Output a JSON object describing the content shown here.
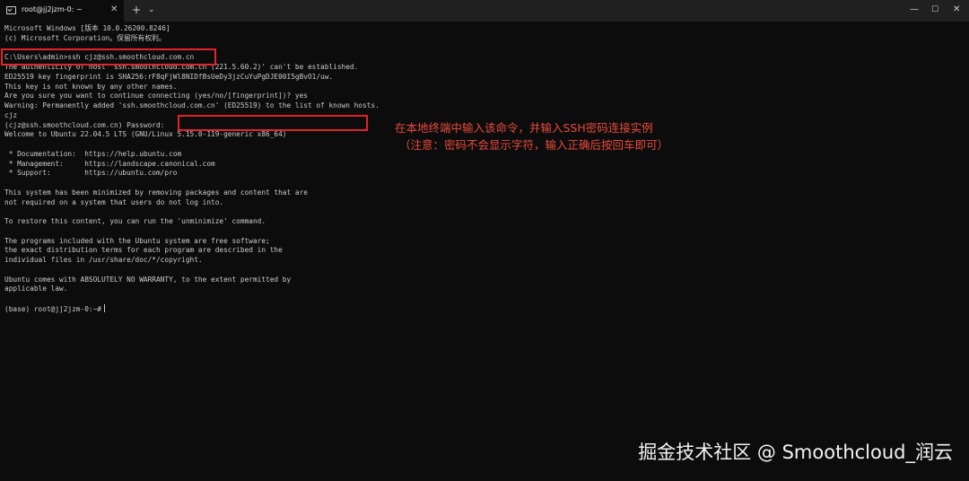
{
  "window": {
    "tab_title": "root@jj2jzm-0: ~",
    "tab_close": "✕",
    "new_tab": "+",
    "tab_dropdown": "⌄",
    "minimize": "—",
    "maximize": "☐",
    "close": "✕"
  },
  "terminal": {
    "lines": [
      "Microsoft Windows [版本 10.0.26200.8246]",
      "(c) Microsoft Corporation。保留所有权利。",
      "",
      "C:\\Users\\admin>ssh cjz@ssh.smoothcloud.com.cn",
      "The authenticity of host 'ssh.smoothcloud.com.cn (221.5.60.2)' can't be established.",
      "ED25519 key fingerprint is SHA256:rF8qFjWl8NIDfBsUeDy3jzCuYuPgDJE00I5gBvO1/uw.",
      "This key is not known by any other names.",
      "Are you sure you want to continue connecting (yes/no/[fingerprint])? yes",
      "Warning: Permanently added 'ssh.smoothcloud.com.cn' (ED25519) to the list of known hosts.",
      "cjz",
      "(cjz@ssh.smoothcloud.com.cn) Password:",
      "Welcome to Ubuntu 22.04.5 LTS (GNU/Linux 5.15.0-119-generic x86_64)",
      "",
      " * Documentation:  https://help.ubuntu.com",
      " * Management:     https://landscape.canonical.com",
      " * Support:        https://ubuntu.com/pro",
      "",
      "This system has been minimized by removing packages and content that are",
      "not required on a system that users do not log into.",
      "",
      "To restore this content, you can run the 'unminimize' command.",
      "",
      "The programs included with the Ubuntu system are free software;",
      "the exact distribution terms for each program are described in the",
      "individual files in /usr/share/doc/*/copyright.",
      "",
      "Ubuntu comes with ABSOLUTELY NO WARRANTY, to the extent permitted by",
      "applicable law.",
      "",
      "(base) root@jj2jzm-0:~#"
    ]
  },
  "annotations": {
    "line1": "在本地终端中输入该命令，并输入SSH密码连接实例",
    "line2": "（注意：密码不会显示字符，输入正确后按回车即可）"
  },
  "watermark": "掘金技术社区 @ Smoothcloud_润云",
  "colors": {
    "terminal_bg": "#0c0c0c",
    "terminal_text": "#cccccc",
    "highlight_red": "#e0242b",
    "annotation_red": "#e84a3a"
  }
}
